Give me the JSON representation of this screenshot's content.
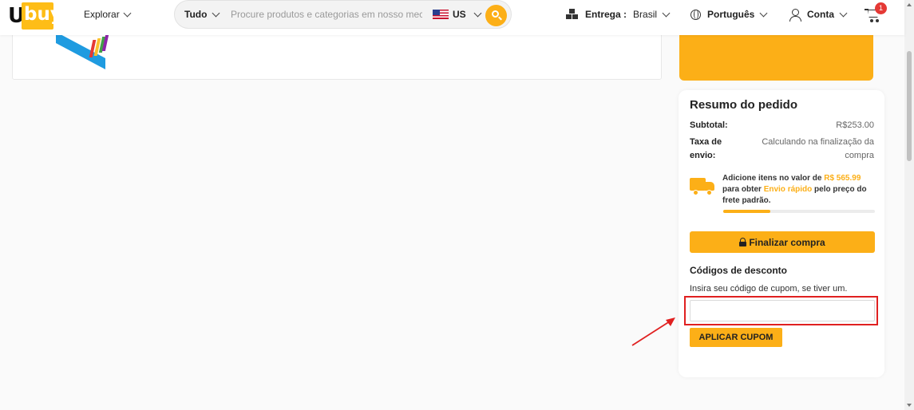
{
  "header": {
    "logo": "Ubuy",
    "explore_label": "Explorar",
    "search": {
      "category": "Tudo",
      "placeholder": "Procure produtos e categorias em nosso mec",
      "country": "US"
    },
    "delivery_label": "Entrega :",
    "delivery_country": "Brasil",
    "language": "Português",
    "account": "Conta",
    "cart_count": "1"
  },
  "summary": {
    "title": "Resumo do pedido",
    "subtotal_label": "Subtotal:",
    "subtotal_value": "R$253.00",
    "shipping_label_1": "Taxa de",
    "shipping_label_2": "envio:",
    "shipping_value_1": "Calculando na finalização da",
    "shipping_value_2": "compra",
    "note": {
      "part1": "Adicione itens no valor de ",
      "amount": "R$ 565.99",
      "part2": " para obter ",
      "fast": "Envio rápido",
      "part3": " pelo preço do frete padrão."
    },
    "progress_percent": 31,
    "checkout_label": "Finalizar compra",
    "discount_title": "Códigos de desconto",
    "discount_help": "Insira seu código de cupom, se tiver um.",
    "coupon_value": "",
    "apply_label": "APLICAR CUPOM"
  },
  "colors": {
    "accent": "#fcaf17",
    "annotation": "#e02020",
    "badge": "#e53935"
  }
}
